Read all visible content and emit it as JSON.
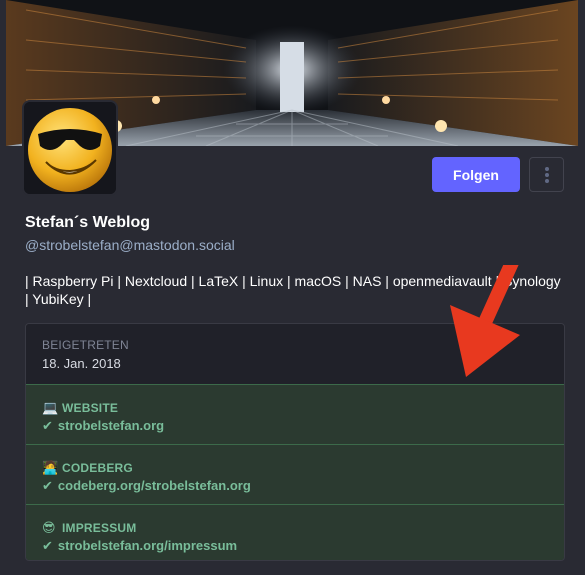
{
  "profile": {
    "display_name": "Stefan´s Weblog",
    "handle": "@strobelstefan@mastodon.social",
    "bio": "| Raspberry Pi | Nextcloud | LaTeX | Linux | macOS | NAS | openmediavault | Synology | YubiKey |",
    "avatar_icon": "sunglasses-smiley-icon"
  },
  "actions": {
    "follow_label": "Folgen",
    "more_icon": "vertical-ellipsis-icon"
  },
  "joined": {
    "label": "BEIGETRETEN",
    "value": "18. Jan. 2018"
  },
  "fields": [
    {
      "emoji": "💻",
      "label": "WEBSITE",
      "value": "strobelstefan.org",
      "icon": "laptop-icon"
    },
    {
      "emoji": "🧑‍💻",
      "label": "CODEBERG",
      "value": "codeberg.org/strobelstefan.org",
      "icon": "technologist-icon"
    },
    {
      "emoji": "😎",
      "label": "IMPRESSUM",
      "value": "strobelstefan.org/impressum",
      "icon": "sunglasses-face-icon"
    }
  ],
  "colors": {
    "accent": "#6364ff",
    "verified": "#79bd9a",
    "annotation_arrow": "#e8391f"
  }
}
